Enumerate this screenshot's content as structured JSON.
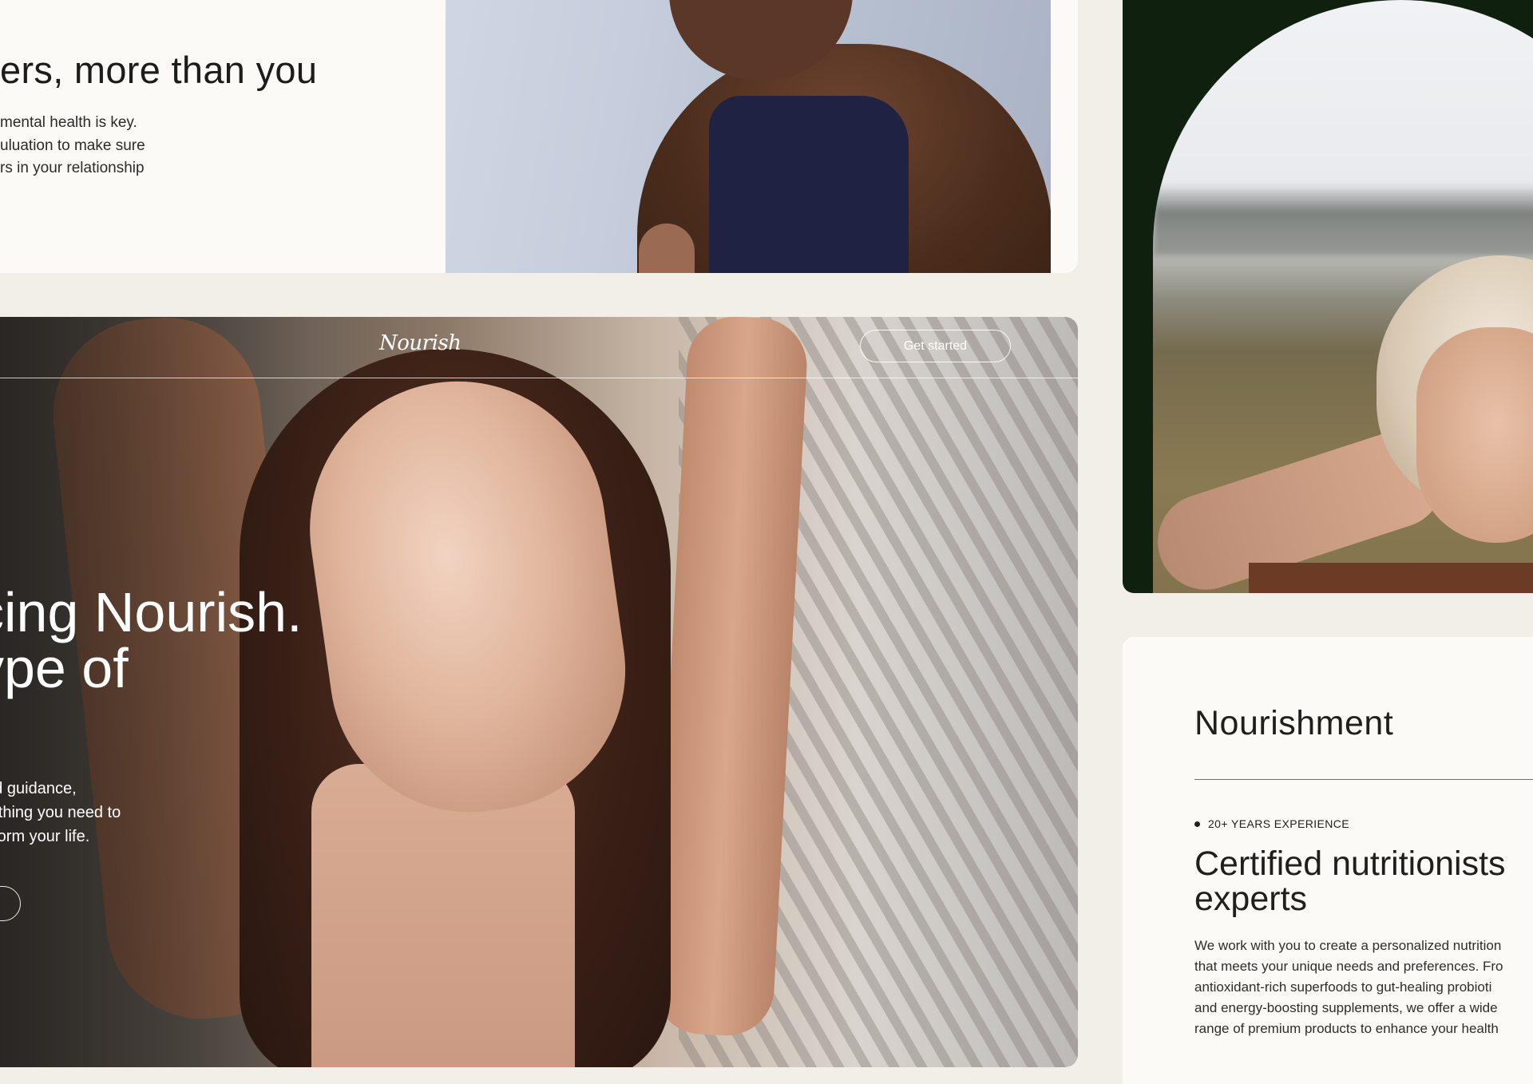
{
  "section_mental": {
    "heading": "ers, more than you",
    "body_lines": [
      "mental health is key.",
      "uluation to make sure",
      "rs in your relationship"
    ]
  },
  "hero": {
    "logo": "Nourish",
    "cta_label": "Get started",
    "title_lines": [
      "cing Nourish.",
      "ype of",
      "."
    ],
    "body_lines": [
      "and guidance,",
      "erything you need to",
      "nsform your life."
    ]
  },
  "info": {
    "brand": "Nourishment",
    "badge": "20+ YEARS EXPERIENCE",
    "heading_lines": [
      "Certified nutritionists",
      "experts"
    ],
    "body_lines": [
      "We work with you to create a personalized nutrition",
      "that meets your unique needs and preferences. Fro",
      "antioxidant-rich superfoods to gut-healing probioti",
      "and energy-boosting supplements, we offer a wide",
      "range of premium products to enhance your health"
    ]
  },
  "colors": {
    "page_bg": "#f2efe9",
    "card_bg": "#fbfaf6",
    "dark_green": "#10200f",
    "text_dark": "#1f1f1c"
  }
}
